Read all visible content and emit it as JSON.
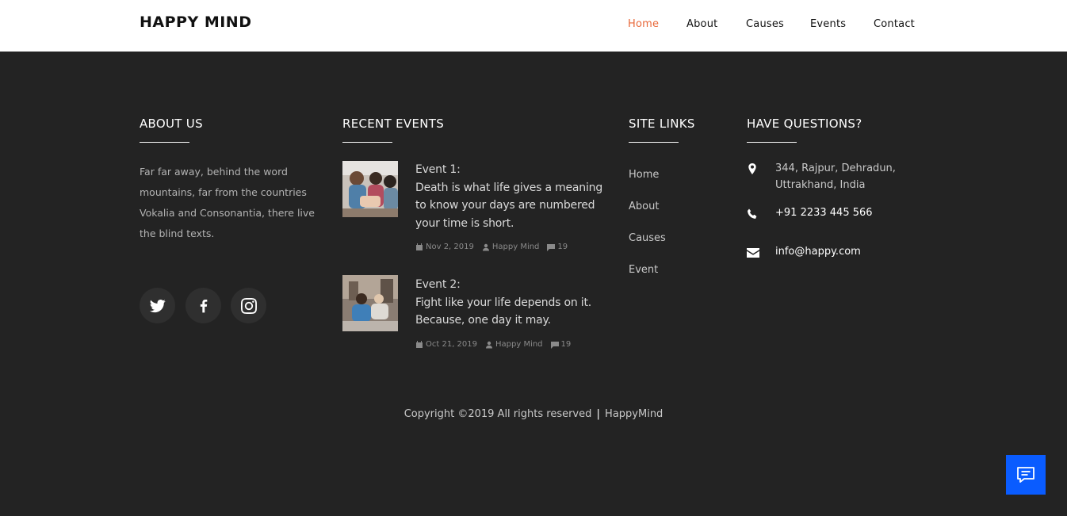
{
  "navbar": {
    "brand": "HAPPY MIND",
    "links": [
      "Home",
      "About",
      "Causes",
      "Events",
      "Contact"
    ],
    "active": "Home",
    "active_color": "#e8683a"
  },
  "footer": {
    "about": {
      "heading": "ABOUT US",
      "text": "Far far away, behind the word mountains, far from the countries Vokalia and Consonantia, there live the blind texts.",
      "social": [
        "twitter-icon",
        "facebook-icon",
        "instagram-icon"
      ]
    },
    "events": {
      "heading": "RECENT EVENTS",
      "items": [
        {
          "label": "Event 1:",
          "text": "Death is what life gives a meaning to know your days are numbered your time is short.",
          "date": "Nov 2, 2019",
          "author": "Happy Mind",
          "comments": "19"
        },
        {
          "label": "Event 2:",
          "text": "Fight like your life depends on it. Because, one day it may.",
          "date": "Oct 21, 2019",
          "author": "Happy Mind",
          "comments": "19"
        }
      ]
    },
    "site_links": {
      "heading": "SITE LINKS",
      "links": [
        "Home",
        "About",
        "Causes",
        "Event"
      ]
    },
    "contact": {
      "heading": "HAVE QUESTIONS?",
      "address": "344, Rajpur, Dehradun, Uttrakhand, India",
      "phone": "+91 2233 445 566",
      "email": "info@happy.com"
    },
    "copyright": {
      "text": "Copyright ©2019 All rights reserved",
      "sep": "|",
      "brand": "HappyMind"
    }
  },
  "colors": {
    "background": "#232323",
    "chat_button": "#0a5cff"
  }
}
